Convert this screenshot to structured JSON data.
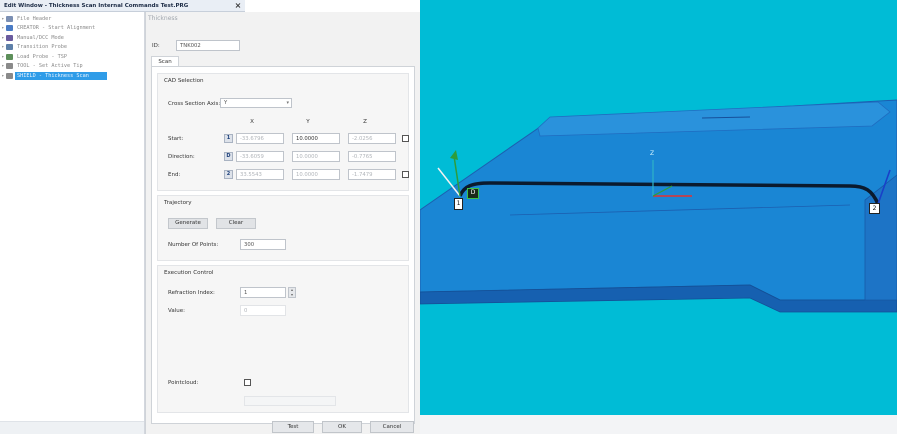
{
  "window": {
    "title": "Edit Window - Thickness Scan Internal Commands Test.PRG",
    "close_glyph": "×"
  },
  "tree": {
    "items": [
      {
        "label": "File Header",
        "icon_color": "#7b8fb3"
      },
      {
        "label": "CREATOR - Start Alignment",
        "icon_color": "#4a7bc4"
      },
      {
        "label": "Manual/DCC Mode",
        "icon_color": "#6a5b9e"
      },
      {
        "label": "Transition Probe",
        "icon_color": "#5d7fa8"
      },
      {
        "label": "Load Probe - TSP",
        "icon_color": "#5d8f5a"
      },
      {
        "label": "TOOL - Set Active Tip",
        "icon_color": "#8a8a8a"
      },
      {
        "label": "SHIELD - Thickness Scan",
        "icon_color": "#8a8a8a",
        "selected": true
      }
    ]
  },
  "dialog": {
    "title": "Thickness",
    "id_label": "ID:",
    "id_value": "TNK002",
    "tab": "Scan",
    "cad": {
      "title": "CAD Selection",
      "axis_label": "Cross Section Axis:",
      "axis_value": "Y",
      "headers": [
        "X",
        "Y",
        "Z"
      ],
      "rows": [
        {
          "label": "Start:",
          "btn": "1",
          "x": "-33.6796",
          "y": "10.0000",
          "z": "-2.0256"
        },
        {
          "label": "Direction:",
          "btn": "D",
          "x": "-33.6059",
          "y": "10.0000",
          "z": "-0.7765"
        },
        {
          "label": "End:",
          "btn": "2",
          "x": "33.5543",
          "y": "10.0000",
          "z": "-1.7479"
        }
      ]
    },
    "trajectory": {
      "title": "Trajectory",
      "generate": "Generate",
      "clear": "Clear",
      "points_label": "Number Of Points:",
      "points_value": "300"
    },
    "execution": {
      "title": "Execution Control",
      "refraction_label": "Refraction Index:",
      "refraction_value": "1",
      "value_label": "Value:",
      "value_value": "0",
      "pointcloud_label": "Pointcloud:"
    },
    "buttons": {
      "test": "Test",
      "ok": "OK",
      "cancel": "Cancel"
    }
  },
  "viewport": {
    "markers": {
      "start": "1",
      "direction": "D",
      "end": "2",
      "z_axis": "Z"
    }
  },
  "colors": {
    "viewport_bg": "#00bcd6",
    "part_fill": "#1a86d4",
    "scan_path": "#0b1a2e",
    "selection": "#2f9ce8"
  }
}
